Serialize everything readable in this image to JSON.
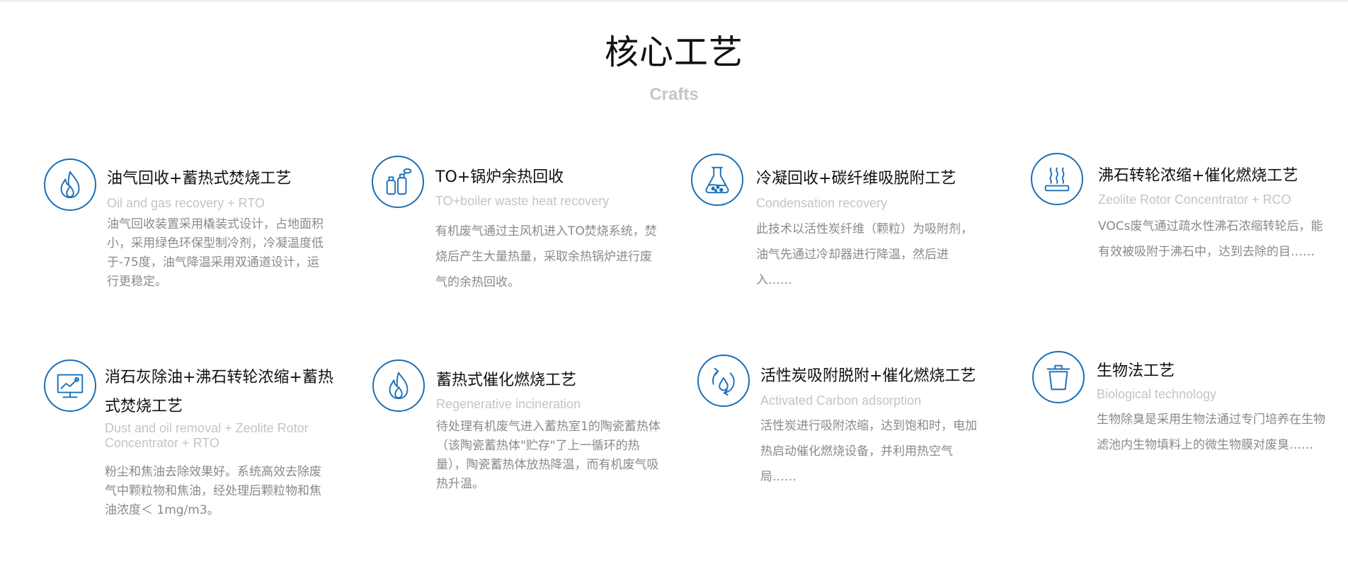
{
  "section": {
    "title": "核心工艺",
    "subtitle": "Crafts"
  },
  "colors": {
    "accent": "#1a6fb8",
    "en_text": "#c4c4c4",
    "desc_text": "#8a8a8a"
  },
  "cards": [
    {
      "icon": "flame-icon",
      "title": "油气回收+蓄热式焚烧工艺",
      "en": "Oil and gas recovery + RTO",
      "desc": "油气回收装置采用橇装式设计，占地面积小，采用绿色环保型制冷剂，冷凝温度低于-75度，油气降温采用双通道设计，运行更稳定。"
    },
    {
      "icon": "gas-cylinders-icon",
      "title": "TO+锅炉余热回收",
      "en": "TO+boiler waste heat recovery",
      "desc": "有机废气通过主风机进入TO焚烧系统，焚烧后产生大量热量，采取余热锅炉进行废气的余热回收。"
    },
    {
      "icon": "flask-icon",
      "title": "冷凝回收+碳纤维吸脱附工艺",
      "en": "Condensation recovery",
      "desc": "此技术以活性炭纤维（颗粒）为吸附剂，油气先通过冷却器进行降温，然后进入……"
    },
    {
      "icon": "heat-waves-icon",
      "title": "沸石转轮浓缩+催化燃烧工艺",
      "en": "Zeolite Rotor Concentrator + RCO",
      "desc": "VOCs废气通过疏水性沸石浓缩转轮后，能有效被吸附于沸石中，达到去除的目……"
    },
    {
      "icon": "monitor-chart-icon",
      "title": "消石灰除油+沸石转轮浓缩+蓄热式焚烧工艺",
      "en": "Dust and oil removal + Zeolite Rotor Concentrator + RTO",
      "desc": "粉尘和焦油去除效果好。系统高效去除废气中颗粒物和焦油，经处理后颗粒物和焦油浓度＜ 1mg/m3。"
    },
    {
      "icon": "flame-icon",
      "title": "蓄热式催化燃烧工艺",
      "en": "Regenerative incineration",
      "desc": "待处理有机废气进入蓄热室1的陶瓷蓄热体（该陶瓷蓄热体\"贮存\"了上一循环的热量），陶瓷蓄热体放热降温，而有机废气吸热升温。"
    },
    {
      "icon": "recycle-drop-icon",
      "title": "活性炭吸附脱附+催化燃烧工艺",
      "en": "Activated Carbon adsorption",
      "desc": "活性炭进行吸附浓缩，达到饱和时，电加热启动催化燃烧设备，并利用热空气局……"
    },
    {
      "icon": "trash-bin-icon",
      "title": "生物法工艺",
      "en": "Biological technology",
      "desc": "生物除臭是采用生物法通过专门培养在生物滤池内生物填料上的微生物膜对废臭……"
    }
  ]
}
